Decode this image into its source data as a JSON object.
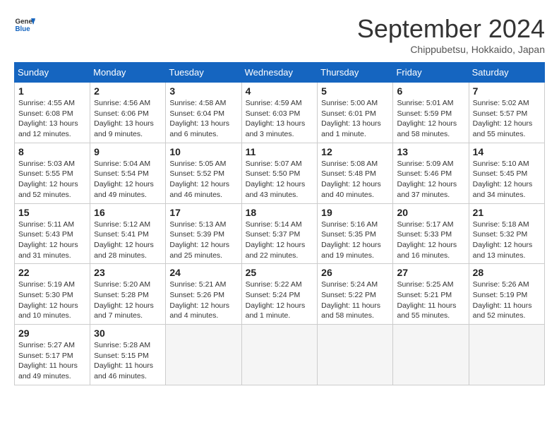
{
  "header": {
    "logo_general": "General",
    "logo_blue": "Blue",
    "month_title": "September 2024",
    "subtitle": "Chippubetsu, Hokkaido, Japan"
  },
  "weekdays": [
    "Sunday",
    "Monday",
    "Tuesday",
    "Wednesday",
    "Thursday",
    "Friday",
    "Saturday"
  ],
  "weeks": [
    [
      {
        "day": "1",
        "info": "Sunrise: 4:55 AM\nSunset: 6:08 PM\nDaylight: 13 hours\nand 12 minutes."
      },
      {
        "day": "2",
        "info": "Sunrise: 4:56 AM\nSunset: 6:06 PM\nDaylight: 13 hours\nand 9 minutes."
      },
      {
        "day": "3",
        "info": "Sunrise: 4:58 AM\nSunset: 6:04 PM\nDaylight: 13 hours\nand 6 minutes."
      },
      {
        "day": "4",
        "info": "Sunrise: 4:59 AM\nSunset: 6:03 PM\nDaylight: 13 hours\nand 3 minutes."
      },
      {
        "day": "5",
        "info": "Sunrise: 5:00 AM\nSunset: 6:01 PM\nDaylight: 13 hours\nand 1 minute."
      },
      {
        "day": "6",
        "info": "Sunrise: 5:01 AM\nSunset: 5:59 PM\nDaylight: 12 hours\nand 58 minutes."
      },
      {
        "day": "7",
        "info": "Sunrise: 5:02 AM\nSunset: 5:57 PM\nDaylight: 12 hours\nand 55 minutes."
      }
    ],
    [
      {
        "day": "8",
        "info": "Sunrise: 5:03 AM\nSunset: 5:55 PM\nDaylight: 12 hours\nand 52 minutes."
      },
      {
        "day": "9",
        "info": "Sunrise: 5:04 AM\nSunset: 5:54 PM\nDaylight: 12 hours\nand 49 minutes."
      },
      {
        "day": "10",
        "info": "Sunrise: 5:05 AM\nSunset: 5:52 PM\nDaylight: 12 hours\nand 46 minutes."
      },
      {
        "day": "11",
        "info": "Sunrise: 5:07 AM\nSunset: 5:50 PM\nDaylight: 12 hours\nand 43 minutes."
      },
      {
        "day": "12",
        "info": "Sunrise: 5:08 AM\nSunset: 5:48 PM\nDaylight: 12 hours\nand 40 minutes."
      },
      {
        "day": "13",
        "info": "Sunrise: 5:09 AM\nSunset: 5:46 PM\nDaylight: 12 hours\nand 37 minutes."
      },
      {
        "day": "14",
        "info": "Sunrise: 5:10 AM\nSunset: 5:45 PM\nDaylight: 12 hours\nand 34 minutes."
      }
    ],
    [
      {
        "day": "15",
        "info": "Sunrise: 5:11 AM\nSunset: 5:43 PM\nDaylight: 12 hours\nand 31 minutes."
      },
      {
        "day": "16",
        "info": "Sunrise: 5:12 AM\nSunset: 5:41 PM\nDaylight: 12 hours\nand 28 minutes."
      },
      {
        "day": "17",
        "info": "Sunrise: 5:13 AM\nSunset: 5:39 PM\nDaylight: 12 hours\nand 25 minutes."
      },
      {
        "day": "18",
        "info": "Sunrise: 5:14 AM\nSunset: 5:37 PM\nDaylight: 12 hours\nand 22 minutes."
      },
      {
        "day": "19",
        "info": "Sunrise: 5:16 AM\nSunset: 5:35 PM\nDaylight: 12 hours\nand 19 minutes."
      },
      {
        "day": "20",
        "info": "Sunrise: 5:17 AM\nSunset: 5:33 PM\nDaylight: 12 hours\nand 16 minutes."
      },
      {
        "day": "21",
        "info": "Sunrise: 5:18 AM\nSunset: 5:32 PM\nDaylight: 12 hours\nand 13 minutes."
      }
    ],
    [
      {
        "day": "22",
        "info": "Sunrise: 5:19 AM\nSunset: 5:30 PM\nDaylight: 12 hours\nand 10 minutes."
      },
      {
        "day": "23",
        "info": "Sunrise: 5:20 AM\nSunset: 5:28 PM\nDaylight: 12 hours\nand 7 minutes."
      },
      {
        "day": "24",
        "info": "Sunrise: 5:21 AM\nSunset: 5:26 PM\nDaylight: 12 hours\nand 4 minutes."
      },
      {
        "day": "25",
        "info": "Sunrise: 5:22 AM\nSunset: 5:24 PM\nDaylight: 12 hours\nand 1 minute."
      },
      {
        "day": "26",
        "info": "Sunrise: 5:24 AM\nSunset: 5:22 PM\nDaylight: 11 hours\nand 58 minutes."
      },
      {
        "day": "27",
        "info": "Sunrise: 5:25 AM\nSunset: 5:21 PM\nDaylight: 11 hours\nand 55 minutes."
      },
      {
        "day": "28",
        "info": "Sunrise: 5:26 AM\nSunset: 5:19 PM\nDaylight: 11 hours\nand 52 minutes."
      }
    ],
    [
      {
        "day": "29",
        "info": "Sunrise: 5:27 AM\nSunset: 5:17 PM\nDaylight: 11 hours\nand 49 minutes."
      },
      {
        "day": "30",
        "info": "Sunrise: 5:28 AM\nSunset: 5:15 PM\nDaylight: 11 hours\nand 46 minutes."
      },
      {
        "day": "",
        "info": ""
      },
      {
        "day": "",
        "info": ""
      },
      {
        "day": "",
        "info": ""
      },
      {
        "day": "",
        "info": ""
      },
      {
        "day": "",
        "info": ""
      }
    ]
  ]
}
